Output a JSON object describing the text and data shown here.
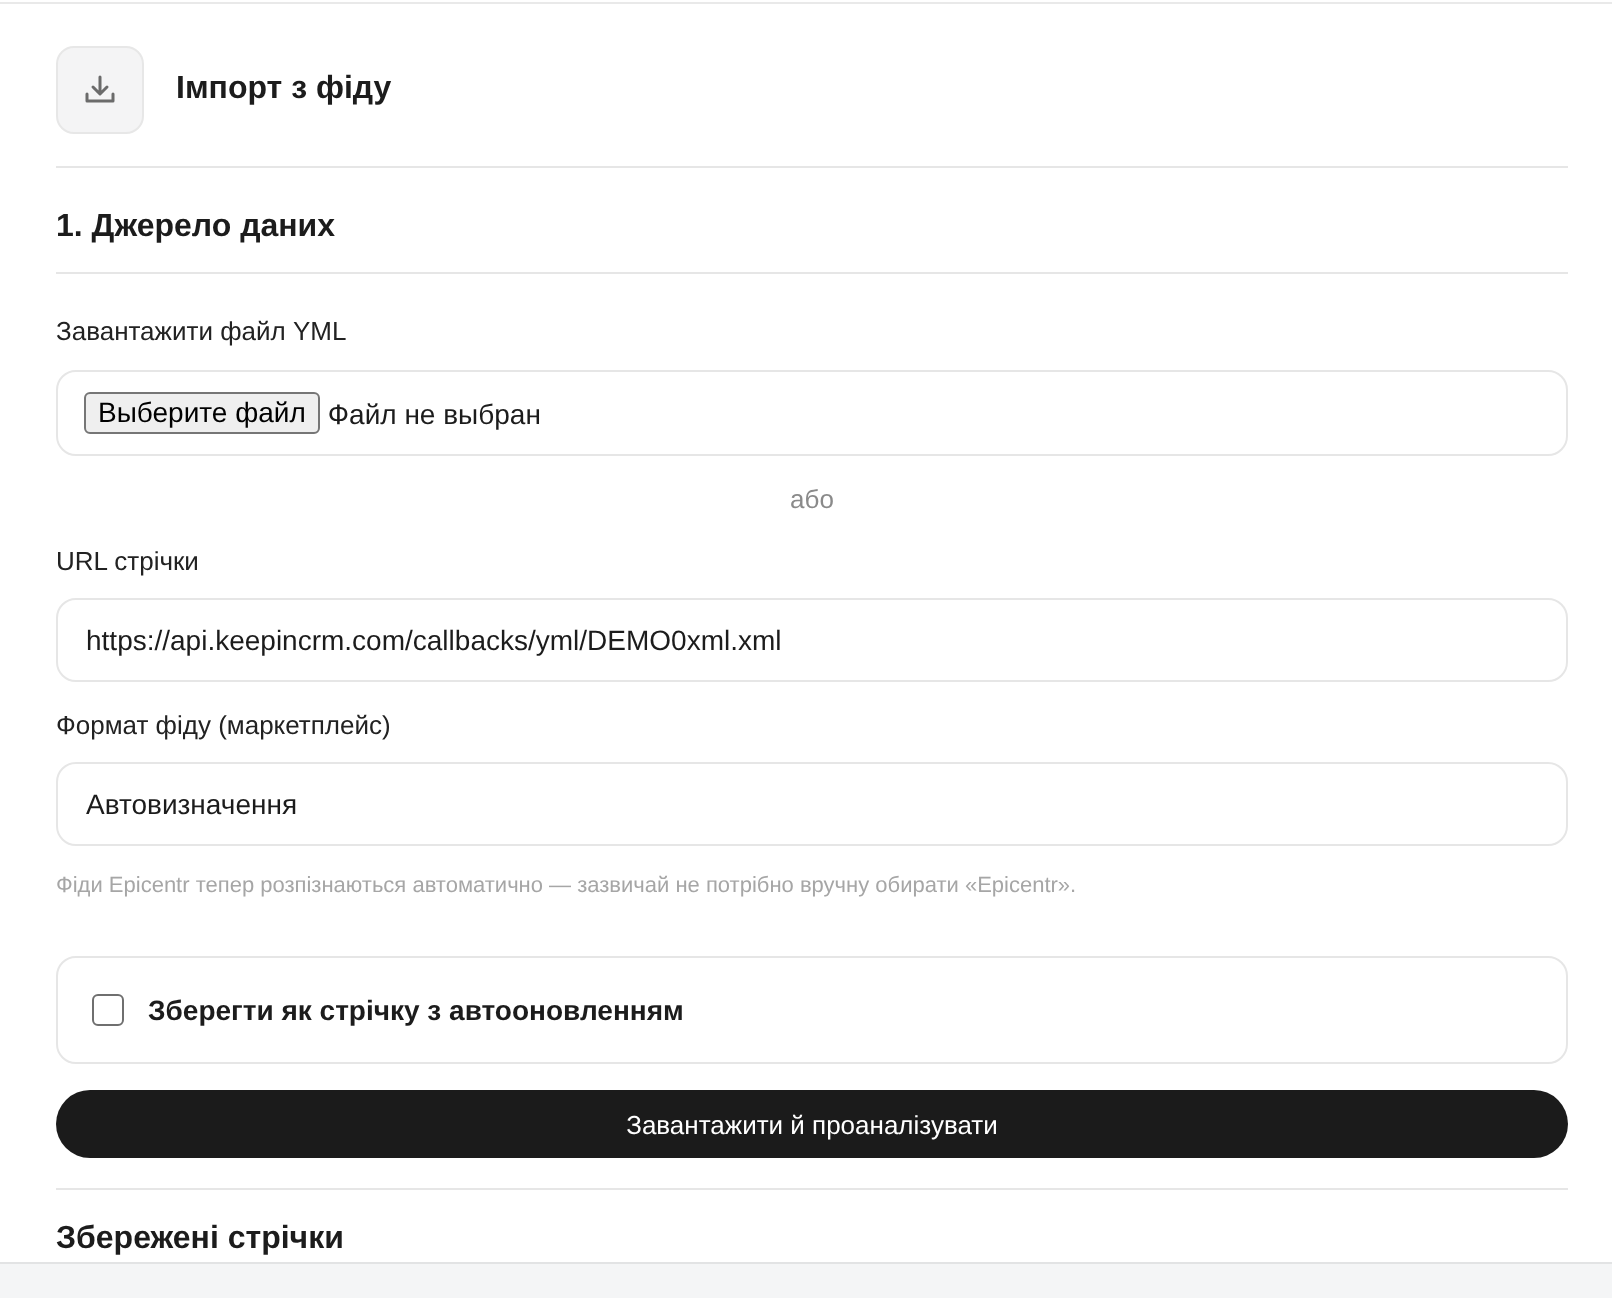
{
  "header": {
    "title": "Імпорт з фіду"
  },
  "section": {
    "title": "1. Джерело даних"
  },
  "file_upload": {
    "label": "Завантажити файл YML",
    "button": "Выберите файл",
    "status": "Файл не выбран"
  },
  "separator": "або",
  "url_field": {
    "label": "URL стрічки",
    "value": "https://api.keepincrm.com/callbacks/yml/DEMO0xml.xml"
  },
  "format_select": {
    "label": "Формат фіду (маркетплейс)",
    "value": "Автовизначення",
    "hint": "Фіди Epicentr тепер розпізнаються автоматично — зазвичай не потрібно вручну обирати «Epicentr»."
  },
  "auto_update": {
    "label": "Зберегти як стрічку з автооновленням",
    "checked": false
  },
  "submit_button": "Завантажити й проаналізувати",
  "next_section": {
    "title": "Збережені стрічки"
  }
}
